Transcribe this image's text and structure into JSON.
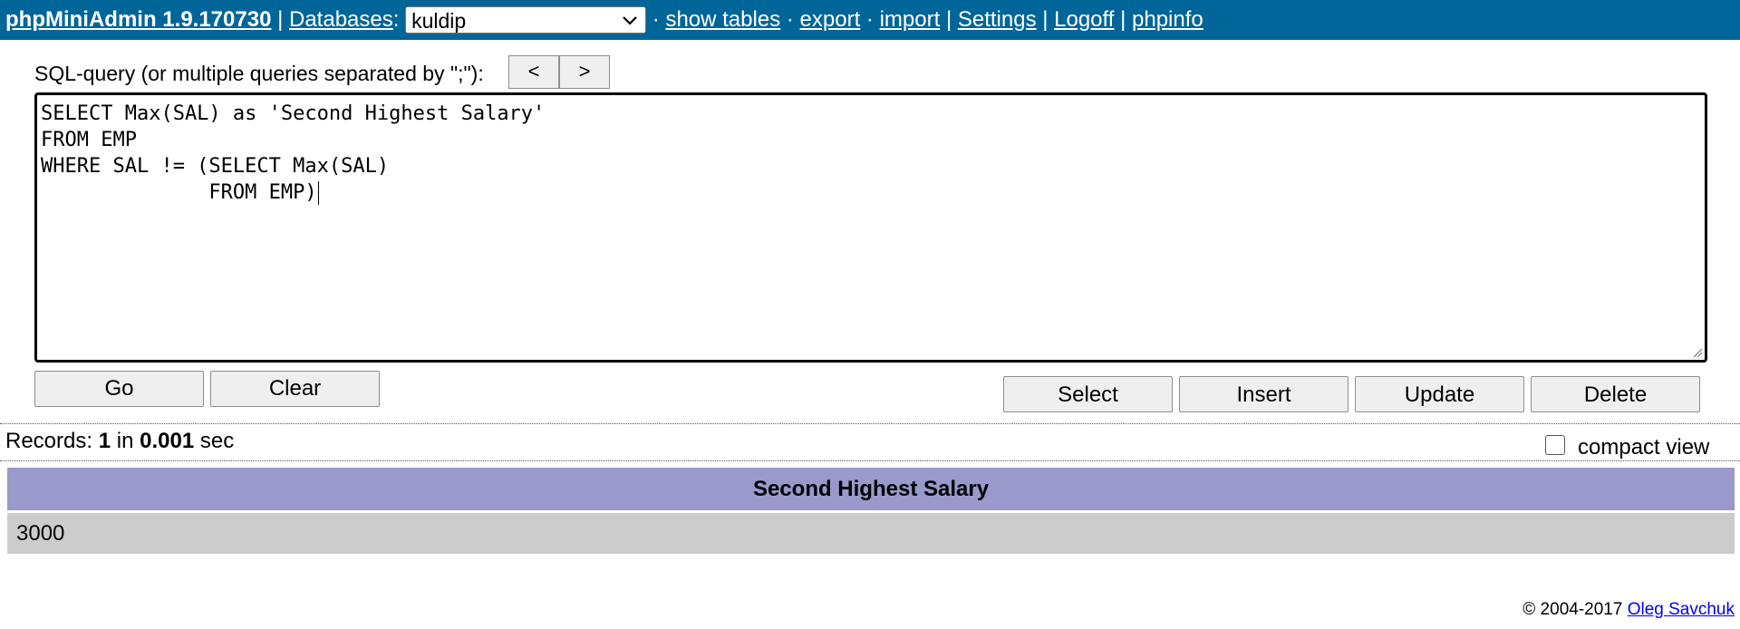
{
  "nav": {
    "brand": "phpMiniAdmin 1.9.170730",
    "separator_pipe": "|",
    "separator_dot": "·",
    "databases_link": "Databases",
    "databases_colon": ":",
    "selected_database": "kuldip",
    "show_tables": "show tables",
    "export": "export",
    "import": "import",
    "settings": "Settings",
    "logoff": "Logoff",
    "phpinfo": "phpinfo"
  },
  "query": {
    "label": "SQL-query (or multiple queries separated by \";\"):",
    "prev_label": "<",
    "next_label": ">",
    "sql_text": "SELECT Max(SAL) as 'Second Highest Salary'\nFROM EMP\nWHERE SAL != (SELECT Max(SAL)\n              FROM EMP)"
  },
  "actions": {
    "go": "Go",
    "clear": "Clear",
    "select": "Select",
    "insert": "Insert",
    "update": "Update",
    "delete": "Delete"
  },
  "result_info": {
    "records_label": "Records:",
    "records_count": "1",
    "in_label": "in",
    "time_value": "0.001",
    "sec_label": "sec",
    "compact_view_label": "compact view",
    "compact_view_checked": false
  },
  "results": {
    "columns": [
      "Second Highest Salary"
    ],
    "rows": [
      [
        "3000"
      ]
    ]
  },
  "footer": {
    "copyright": "© 2004-2017",
    "author_link": "Oleg Savchuk"
  },
  "colors": {
    "nav_background": "#006699",
    "table_header": "#9999cc",
    "table_row": "#cccccc"
  }
}
